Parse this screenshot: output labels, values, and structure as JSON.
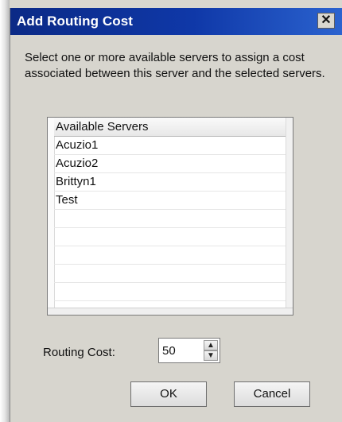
{
  "dialog": {
    "title": "Add Routing Cost",
    "close_glyph": "✕",
    "description": "Select one or more available servers to assign a cost associated between this server and the selected servers."
  },
  "server_list": {
    "header": "Available Servers",
    "items": [
      "Acuzio1",
      "Acuzio2",
      "Brittyn1",
      "Test"
    ]
  },
  "routing_cost": {
    "label": "Routing Cost:",
    "value": "50",
    "spin_up_glyph": "▲",
    "spin_down_glyph": "▼"
  },
  "buttons": {
    "ok": "OK",
    "cancel": "Cancel"
  },
  "colors": {
    "titlebar_start": "#0b2a86",
    "titlebar_end": "#2b63cf",
    "dialog_bg": "#d7d5ce"
  }
}
